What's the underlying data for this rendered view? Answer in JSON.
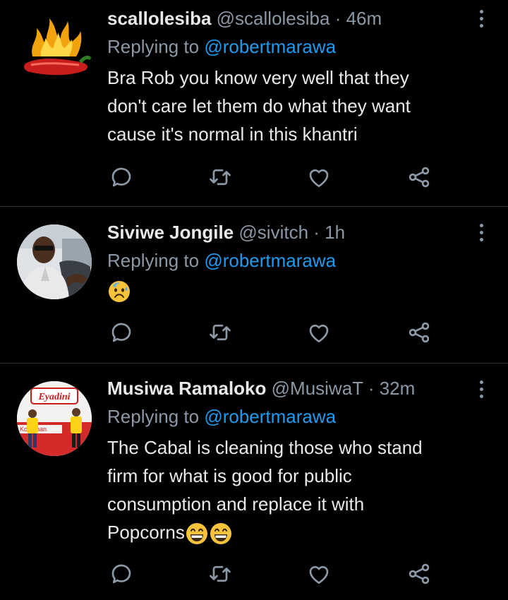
{
  "tweets": [
    {
      "name": "scallolesiba",
      "handle": "@scallolesiba",
      "time": "· 46m",
      "reply_prefix": "Replying to",
      "mention": "@robertmarawa",
      "lines": [
        "Bra Rob you know very well that they",
        "don't care let them do what they want",
        "cause it's normal in this khantri"
      ]
    },
    {
      "name": "Siviwe Jongile",
      "handle": "@sivitch",
      "time": "· 1h",
      "reply_prefix": "Replying to",
      "mention": "@robertmarawa",
      "emoji": "worried-face-sweat"
    },
    {
      "name": "Musiwa Ramaloko",
      "handle": "@MusiwaT",
      "time": "· 32m",
      "reply_prefix": "Replying to",
      "mention": "@robertmarawa",
      "lines": [
        "The Cabal is cleaning those who stand",
        "firm for what is good for public",
        "consumption and replace it with",
        "Popcorns"
      ],
      "avatar_sign": "Eyadini",
      "avatar_banner": "Kokuman"
    }
  ],
  "icons": {
    "reply": "reply-icon",
    "retweet": "retweet-icon",
    "like": "like-icon",
    "share": "share-icon",
    "more": "more-icon"
  },
  "colors": {
    "background": "#000000",
    "text": "#e7e9ea",
    "secondary": "#8b98a5",
    "accent": "#1d9bf0",
    "divider": "#2f3336"
  }
}
